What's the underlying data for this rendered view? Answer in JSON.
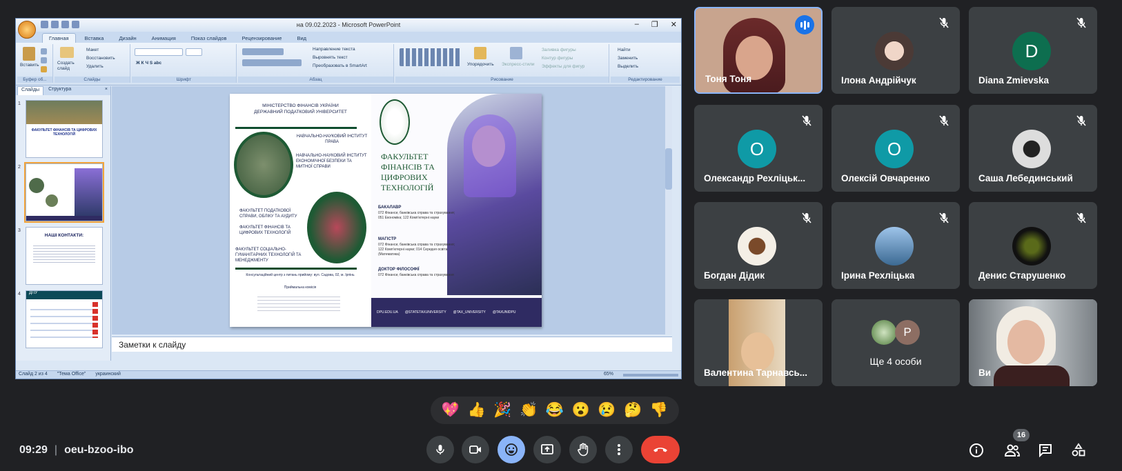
{
  "ppt": {
    "title": "на 09.02.2023 - Microsoft PowerPoint",
    "tabs": [
      "Главная",
      "Вставка",
      "Дизайн",
      "Анимация",
      "Показ слайдов",
      "Рецензирование",
      "Вид"
    ],
    "ribbon": {
      "paste": "Вставить",
      "new_slide": "Создать слайд",
      "layout": "Макет",
      "reset": "Восстановить",
      "delete": "Удалить",
      "text_dir": "Направление текста",
      "align_text": "Выровнять текст",
      "smartart": "Преобразовать в SmartArt",
      "arrange": "Упорядочить",
      "quick_styles": "Экспресс-стили",
      "shape_fill": "Заливка фигуры",
      "shape_outline": "Контур фигуры",
      "shape_effects": "Эффекты для фигур",
      "find": "Найти",
      "replace": "Заменить",
      "select": "Выделить",
      "groups": [
        "Буфер об...",
        "Слайды",
        "Шрифт",
        "Абзац",
        "Рисование",
        "Редактирование"
      ]
    },
    "pane_tabs": [
      "Слайды",
      "Структура"
    ],
    "thumbs": [
      {
        "num": "1",
        "banner": "ФАКУЛЬТЕТ ФІНАНСІВ ТА ЦИФРОВИХ ТЕХНОЛОГІЙ"
      },
      {
        "num": "2"
      },
      {
        "num": "3",
        "heading": "НАШІ КОНТАКТИ:"
      },
      {
        "num": "4",
        "heading": "ДПУ"
      }
    ],
    "notes_placeholder": "Заметки к слайду",
    "status": [
      "Слайд 2 из 4",
      "\"Тема Office\"",
      "украинский"
    ],
    "zoom": "65%"
  },
  "slide": {
    "ministry": "МІНІСТЕРСТВО ФІНАНСІВ УКРАЇНИ",
    "university": "ДЕРЖАВНИЙ ПОДАТКОВИЙ УНІВЕРСИТЕТ",
    "inst1": "НАВЧАЛЬНО-НАУКОВИЙ ІНСТИТУТ ПРАВА",
    "inst2": "НАВЧАЛЬНО-НАУКОВИЙ ІНСТИТУТ ЕКОНОМІЧНОЇ БЕЗПЕКИ ТА МИТНОЇ СПРАВИ",
    "fac1": "ФАКУЛЬТЕТ ПОДАТКОВОЇ СПРАВИ, ОБЛІКУ ТА АУДИТУ",
    "fac2": "ФАКУЛЬТЕТ ФІНАНСІВ ТА ЦИФРОВИХ ТЕХНОЛОГІЙ",
    "fac3": "ФАКУЛЬТЕТ СОЦІАЛЬНО-ГУМАНІТАРНИХ ТЕХНОЛОГІЙ ТА МЕНЕДЖМЕНТУ",
    "contacts1": "Консультаційний центр з питань прийому: вул. Садова, 02, м. Ірпінь",
    "contacts2": "Приймальна комісія",
    "faculty_title": "ФАКУЛЬТЕТ ФІНАНСІВ ТА ЦИФРОВИХ ТЕХНОЛОГІЙ",
    "bachelor": "БАКАЛАВР",
    "bachelor_text": "072 Фінанси, банківська справа та страхування; 051 Економіка; 122 Комп'ютерні науки",
    "master": "МАГІСТР",
    "master_text": "072 Фінанси, банківська справа та страхування; 122 Комп'ютерні науки; 014 Середня освіта (Математика)",
    "phd": "ДОКТОР ФІЛОСОФІЇ",
    "phd_text": "072 Фінанси, банківська справа та страхування",
    "socials": [
      "DPU.EDU.UA",
      "@STATETAXUNIVERSITY",
      "@TAX_UNIVERSITY",
      "@TAXUNIDPU"
    ]
  },
  "participants": [
    {
      "name": "Тоня Тоня",
      "speaking": true
    },
    {
      "name": "Ілона Андрійчук"
    },
    {
      "name": "Diana Zmievska",
      "initial": "D",
      "color": "#0d6e4f"
    },
    {
      "name": "Олександр Рехліцьк...",
      "initial": "О",
      "color": "#0f9aa6"
    },
    {
      "name": "Олексій Овчаренко",
      "initial": "О",
      "color": "#0f9aa6"
    },
    {
      "name": "Саша Лебединський"
    },
    {
      "name": "Богдан Дідик"
    },
    {
      "name": "Ірина Рехліцька"
    },
    {
      "name": "Денис Старушенко"
    },
    {
      "name": "Валентина Тарнавсь..."
    },
    {
      "name": "Ще 4 особи",
      "initial": "Р"
    },
    {
      "name": "Ви"
    }
  ],
  "reactions": [
    "💖",
    "👍",
    "🎉",
    "👏",
    "😂",
    "😮",
    "😢",
    "🤔",
    "👎"
  ],
  "bar": {
    "time": "09:29",
    "separator": "|",
    "code": "oeu-bzoo-ibo",
    "people_count": "16"
  },
  "colors": {
    "end_call": "#ea4335",
    "active_control": "#8ab4f8",
    "tile": "#3c4043"
  }
}
